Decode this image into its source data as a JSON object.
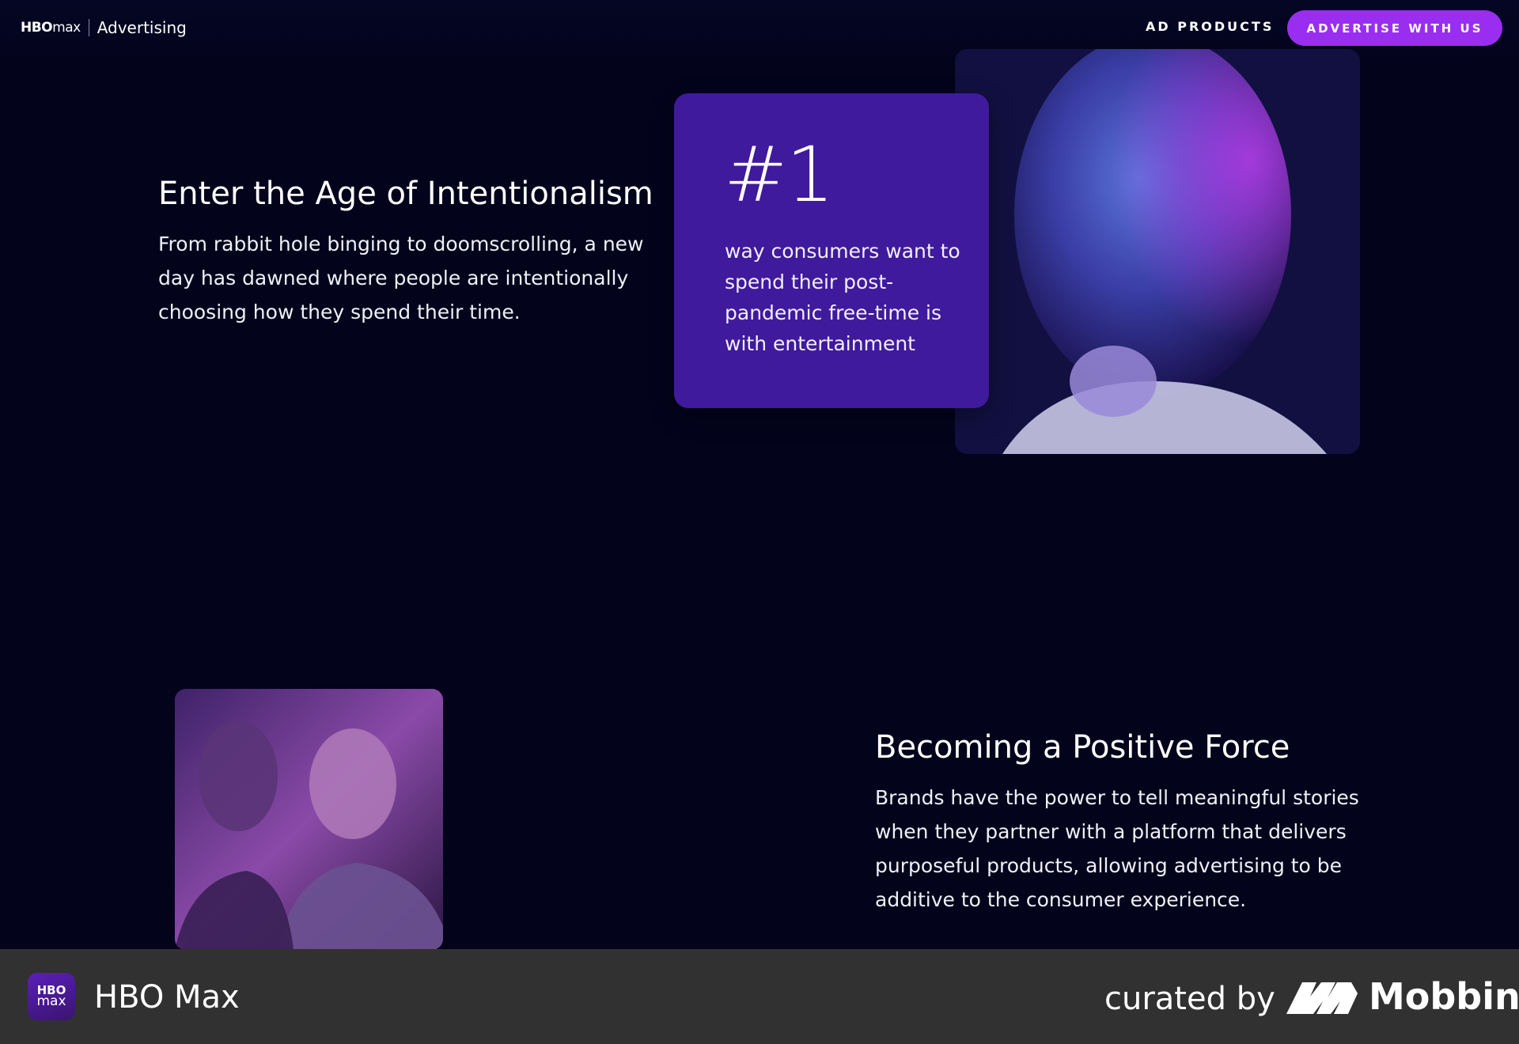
{
  "header": {
    "brand_logo_bold": "HBO",
    "brand_logo_light": "max",
    "brand_name": "Advertising",
    "nav_ad_products": "AD PRODUCTS",
    "cta_label": "ADVERTISE WITH US",
    "accent": "#9a2ef0"
  },
  "section1": {
    "title": "Enter the Age of Intentionalism",
    "body": "From rabbit hole binging to doomscrolling, a new day has dawned where people are intentionally choosing how they spend their time.",
    "stat_number": "#1",
    "stat_text": "way consumers want to spend their post-pandemic free-time is with entertainment",
    "stat_card_color": "#401a9c"
  },
  "section2": {
    "title": "Becoming a Positive Force",
    "body": "Brands have the power to tell meaningful stories when they partner with a platform that delivers purposeful products, allowing advertising to be additive to the consumer experience."
  },
  "footer": {
    "app_icon_top": "HBO",
    "app_icon_bottom": "max",
    "app_name": "HBO Max",
    "curated_by": "curated by",
    "mobbin_name": "Mobbin"
  }
}
